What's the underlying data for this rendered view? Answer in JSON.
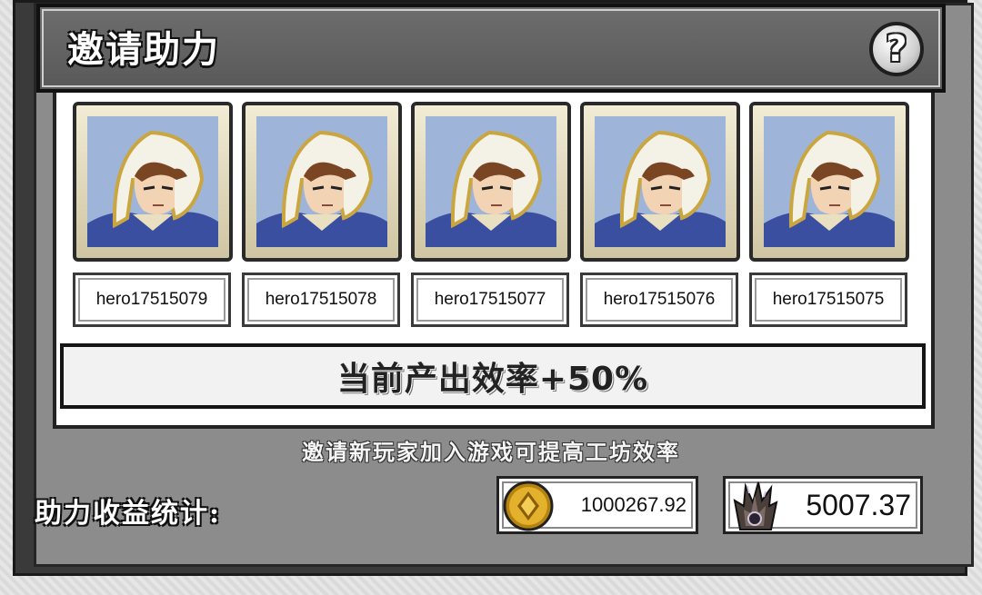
{
  "header": {
    "title": "邀请助力",
    "help_glyph": "?"
  },
  "heroes": [
    {
      "name": "hero17515079",
      "icon": "hooded-hero-portrait"
    },
    {
      "name": "hero17515078",
      "icon": "hooded-hero-portrait"
    },
    {
      "name": "hero17515077",
      "icon": "hooded-hero-portrait"
    },
    {
      "name": "hero17515076",
      "icon": "hooded-hero-portrait"
    },
    {
      "name": "hero17515075",
      "icon": "hooded-hero-portrait"
    }
  ],
  "efficiency": {
    "text": "当前产出效率+50%"
  },
  "invite_hint": "邀请新玩家加入游戏可提高工坊效率",
  "stats": {
    "label": "助力收益统计:",
    "gold": {
      "icon": "gold-coin-icon",
      "value": "1000267.92"
    },
    "crystal": {
      "icon": "crystal-icon",
      "value": "5007.37"
    }
  },
  "colors": {
    "panel": "#8c8c8c",
    "header": "#5f5f5f",
    "gold": "#d9a520",
    "hero_bg": "#9fb4d9"
  }
}
